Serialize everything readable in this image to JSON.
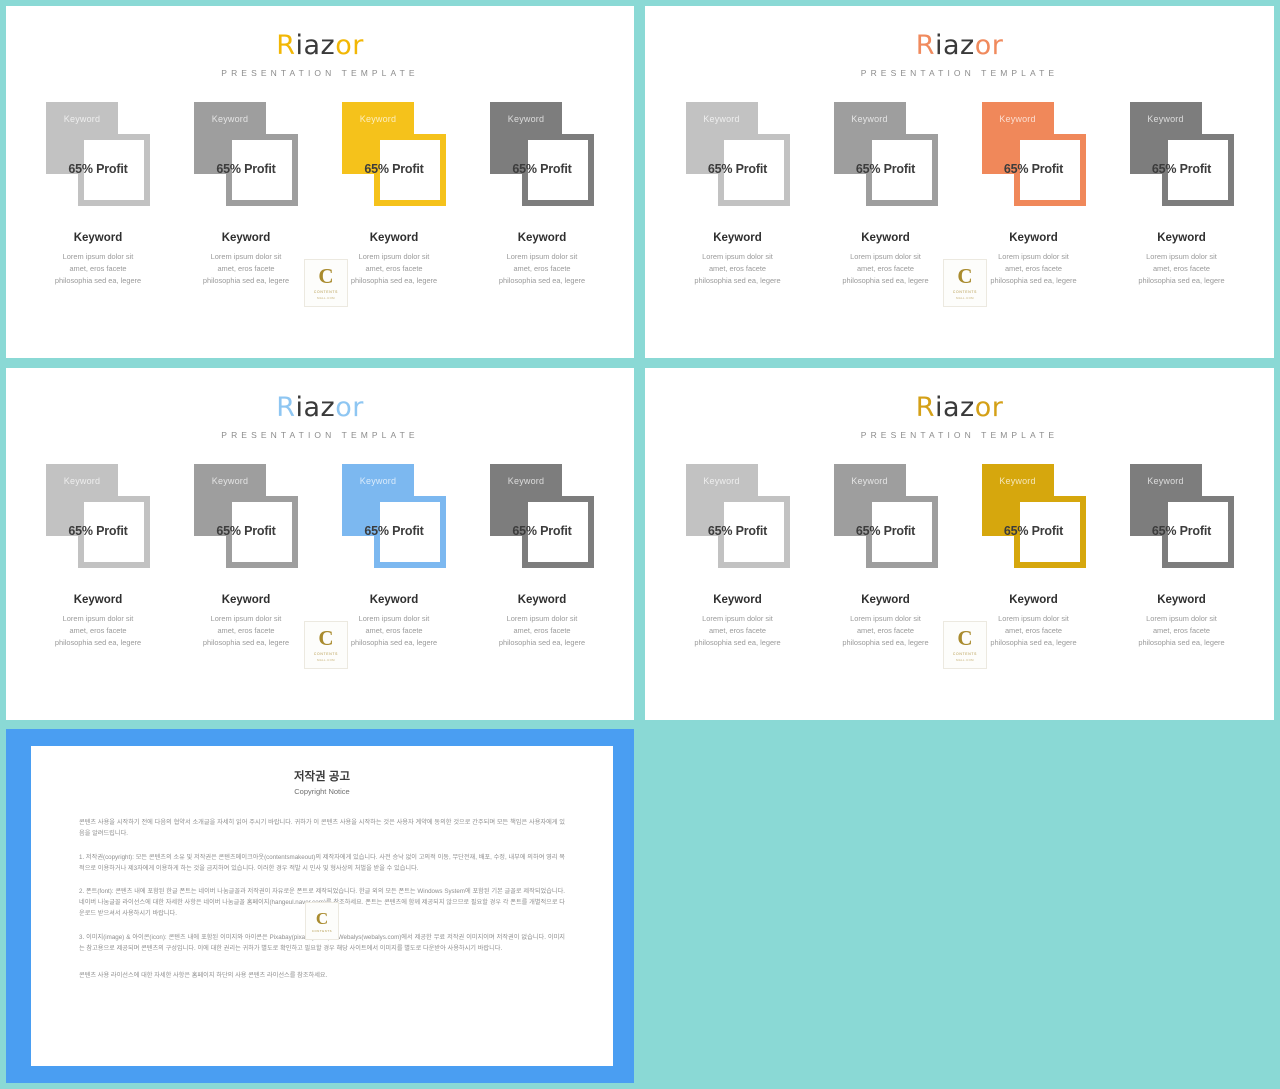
{
  "background_color": "#8ad9d5",
  "brand": {
    "part1": "R",
    "part2": "iaz",
    "part3": "or",
    "subtitle": "PRESENTATION  TEMPLATE"
  },
  "card": {
    "keyword_overlay": "Keyword",
    "stat": "65% Profit",
    "caption_title": "Keyword",
    "caption_body": "Lorem ipsum dolor sit\namet, eros facete\nphilosophia sed ea, legere"
  },
  "watermark": {
    "letter": "C",
    "line1": "CONTENTS",
    "line2": "MALL.COM"
  },
  "slides": [
    {
      "id": "slide-1",
      "accent": "#F2B705",
      "mid_color": "#3a3a3a",
      "cards": [
        {
          "fill": "#c2c2c2",
          "border": "#c2c2c2",
          "highlight": false
        },
        {
          "fill": "#9e9e9e",
          "border": "#9e9e9e",
          "highlight": false
        },
        {
          "fill": "#F5C21B",
          "border": "#F5C21B",
          "highlight": true
        },
        {
          "fill": "#7d7d7d",
          "border": "#7d7d7d",
          "highlight": false
        }
      ]
    },
    {
      "id": "slide-2",
      "accent": "#F08A5D",
      "mid_color": "#3a3a3a",
      "cards": [
        {
          "fill": "#c2c2c2",
          "border": "#c2c2c2",
          "highlight": false
        },
        {
          "fill": "#9e9e9e",
          "border": "#9e9e9e",
          "highlight": false
        },
        {
          "fill": "#F0885A",
          "border": "#F0885A",
          "highlight": true
        },
        {
          "fill": "#7d7d7d",
          "border": "#7d7d7d",
          "highlight": false
        }
      ]
    },
    {
      "id": "slide-3",
      "accent": "#8EC6F2",
      "mid_color": "#3a3a3a",
      "cards": [
        {
          "fill": "#c2c2c2",
          "border": "#c2c2c2",
          "highlight": false
        },
        {
          "fill": "#9e9e9e",
          "border": "#9e9e9e",
          "highlight": false
        },
        {
          "fill": "#7CB8F0",
          "border": "#7CB8F0",
          "highlight": true
        },
        {
          "fill": "#7d7d7d",
          "border": "#7d7d7d",
          "highlight": false
        }
      ]
    },
    {
      "id": "slide-4",
      "accent": "#D4A017",
      "mid_color": "#3a3a3a",
      "cards": [
        {
          "fill": "#c2c2c2",
          "border": "#c2c2c2",
          "highlight": false
        },
        {
          "fill": "#9e9e9e",
          "border": "#9e9e9e",
          "highlight": false
        },
        {
          "fill": "#D6A70D",
          "border": "#D6A70D",
          "highlight": true
        },
        {
          "fill": "#7d7d7d",
          "border": "#7d7d7d",
          "highlight": false
        }
      ]
    }
  ],
  "copyright": {
    "frame_color": "#4a9ef2",
    "title": "저작권 공고",
    "subtitle": "Copyright Notice",
    "intro": "콘텐츠 사용을 시작하기 전에 다음의 협약서 소개글을 자세히 읽어 주시기 바랍니다. 귀하가 이 콘텐츠 사용을 시작하는 것은 사용자 계약에 동의한 것으로 간주되며 모든 책임은 사용자에게 있음을 알려드립니다.",
    "item1": "1. 저작권(copyright): 모든 콘텐츠의 소유 및 저작권은 콘텐츠메이크아웃(contentsmakeout)의 제작자에게 있습니다. 사전 승낙 없이 고의적 이동, 무단전재, 배포, 수정, 내부에 의하여 영리 목적으로 이용하거나 제3자에게 이용하게 하는 것을 금지하여 있습니다. 이러한 경우 적발 시 민사 및 형사상의 처벌을 받을 수 있습니다.",
    "item2": "2. 폰트(font): 콘텐츠 내에 포함된 한글 폰트는 네이버 나눔글꼴과 저작권이 자유로운 폰트로 제작되었습니다. 한글 외의 모든 폰트는 Windows System에 포함된 기본 글꼴로 제작되었습니다. 네이버 나눔글꼴 라이선스에 대한 자세한 사항은 네이버 나눔글꼴 홈페이지(hangeul.naver.com)를 참조하세요. 폰트는 콘텐츠에 함께 제공되지 않으므로 필요할 경우 각 폰트를 개별적으로 다운로드 받으셔서 사용하시기 바랍니다.",
    "item3": "3. 이미지(image) & 아이콘(icon): 콘텐츠 내에 포함된 이미지와 아이콘은 Pixabay(pixabay.com)와 Webalys(webalys.com)에서 제공한 무료 저작권 이미지이며 저작권이 없습니다. 이미지는 참고용으로 제공되며 콘텐츠의 구성입니다. 이에 대한 권리는 귀하가 별도로 확인하고 필요할 경우 해당 사이트에서 이미지를 별도로 다운받아 사용하시기 바랍니다.",
    "footer": "콘텐츠 사용 라이선스에 대한 자세한 사항은 홈페이지 하단의 사용 콘텐츠 라이선스를 참조하세요."
  }
}
